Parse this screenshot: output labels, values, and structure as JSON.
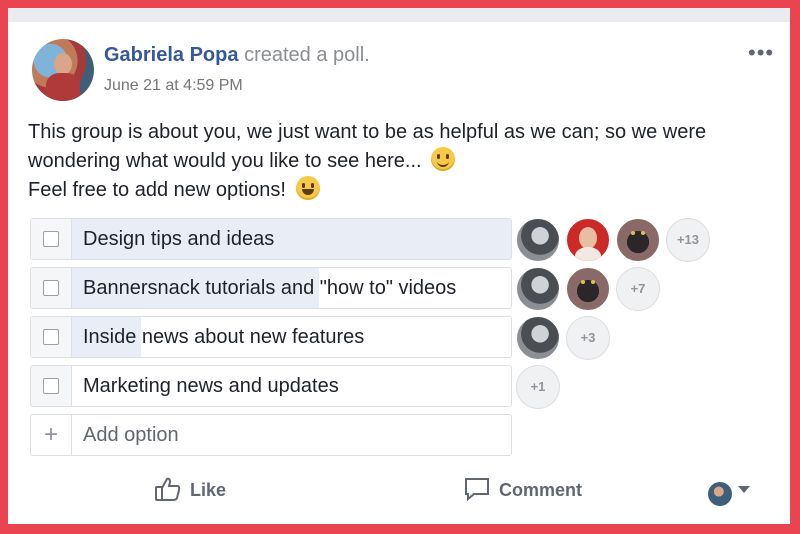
{
  "post": {
    "author_name": "Gabriela Popa",
    "action_text": "created a poll.",
    "timestamp": "June 21 at 4:59 PM",
    "lines": [
      "This group is about you, we just want to be as helpful as we can; so we were",
      "wondering what would you like to see here...",
      "Feel free to add new options!"
    ],
    "emojis": [
      "slightly-smiling-face",
      "grinning-face"
    ]
  },
  "poll": {
    "options": [
      {
        "label": "Design tips and ideas",
        "vote_share": 1.0,
        "extra_count": "+13"
      },
      {
        "label": "Bannersnack tutorials and \"how to\" videos",
        "vote_share": 0.6,
        "extra_count": "+7"
      },
      {
        "label": "Inside news about new features",
        "vote_share": 0.23,
        "extra_count": "+3"
      },
      {
        "label": "Marketing news and updates",
        "vote_share": 0.06,
        "extra_count": "+1"
      }
    ],
    "add_option_placeholder": "Add option"
  },
  "actions": {
    "like_label": "Like",
    "comment_label": "Comment"
  },
  "colors": {
    "brand_link": "#365899",
    "frame": "#e9444f",
    "vote_fill": "#e9edf6"
  }
}
